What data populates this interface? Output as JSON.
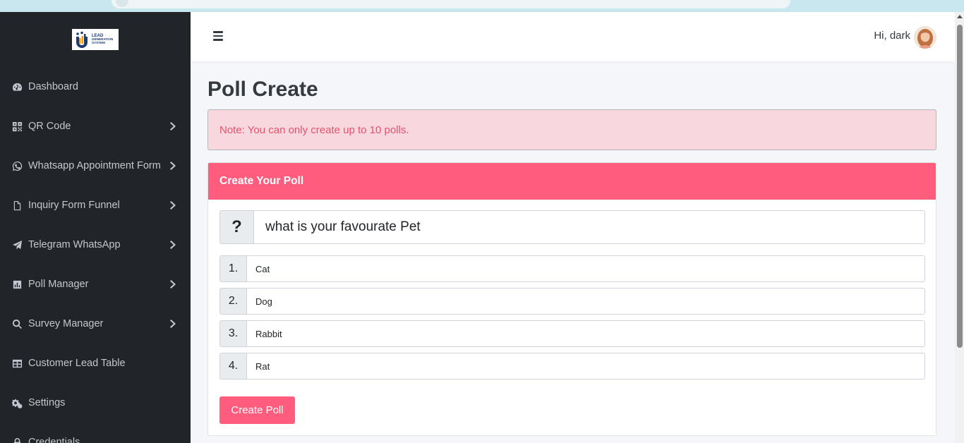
{
  "sidebar": {
    "brand": {
      "line1": "LEAD",
      "line2": "GENERATION",
      "line3": "SYSTEM"
    },
    "items": [
      {
        "label": "Dashboard",
        "icon": "gauge-icon",
        "has_submenu": false
      },
      {
        "label": "QR Code",
        "icon": "qrcode-icon",
        "has_submenu": true
      },
      {
        "label": "Whatsapp Appointment Form",
        "icon": "whatsapp-icon",
        "has_submenu": true
      },
      {
        "label": "Inquiry Form Funnel",
        "icon": "file-icon",
        "has_submenu": true
      },
      {
        "label": "Telegram WhatsApp",
        "icon": "paper-plane-icon",
        "has_submenu": true
      },
      {
        "label": "Poll Manager",
        "icon": "poll-chart-icon",
        "has_submenu": true
      },
      {
        "label": "Survey Manager",
        "icon": "search-icon",
        "has_submenu": true
      },
      {
        "label": "Customer Lead Table",
        "icon": "table-icon",
        "has_submenu": false
      },
      {
        "label": "Settings",
        "icon": "gears-icon",
        "has_submenu": false
      },
      {
        "label": "Credentials",
        "icon": "lock-icon",
        "has_submenu": false
      }
    ]
  },
  "header": {
    "greeting": "Hi, dark"
  },
  "main": {
    "title": "Poll Create",
    "alert": "Note: You can only create up to 10 polls.",
    "card": {
      "title": "Create Your Poll",
      "question_addon": "?",
      "question": "what is your favourate Pet",
      "options": [
        {
          "number": "1.",
          "value": "Cat"
        },
        {
          "number": "2.",
          "value": "Dog"
        },
        {
          "number": "3.",
          "value": "Rabbit"
        },
        {
          "number": "4.",
          "value": "Rat"
        }
      ],
      "submit_label": "Create Poll"
    }
  },
  "colors": {
    "sidebar_bg": "#212529",
    "accent": "#ff5c7e",
    "alert_bg": "#f8d7de",
    "alert_text": "#e8506e"
  }
}
